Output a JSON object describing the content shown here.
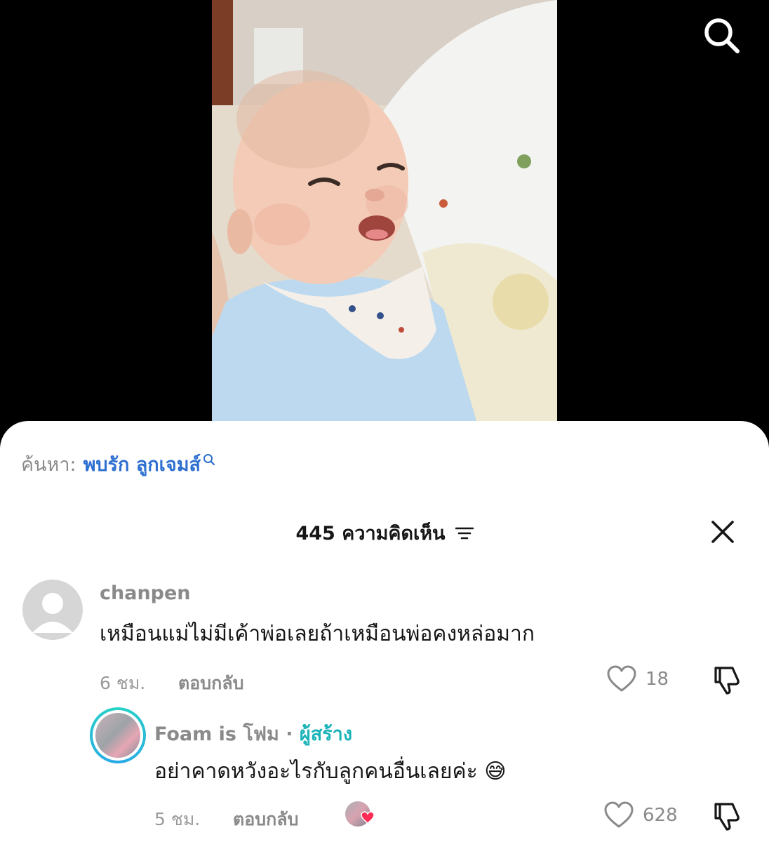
{
  "search_suggestion": {
    "prefix": "ค้นหา:",
    "term": "พบรัก ลูกเจมส์"
  },
  "comments_header": {
    "count": "445",
    "label": "ความคิดเห็น"
  },
  "comments": [
    {
      "username": "chanpen",
      "text": "เหมือนแม่ไม่มีเค้าพ่อเลยถ้าเหมือนพ่อคงหล่อมาก",
      "time": "6 ชม.",
      "reply_label": "ตอบกลับ",
      "likes": "18"
    },
    {
      "username": "Foam is โฟม",
      "separator": "·",
      "badge": "ผู้สร้าง",
      "text": "อย่าคาดหวังอะไรกับลูกคนอื่นเลยค่ะ 😅",
      "time": "5 ชม.",
      "reply_label": "ตอบกลับ",
      "likes": "628"
    }
  ],
  "icons": {
    "search": "search-icon",
    "close": "close-icon",
    "sort": "sort-icon",
    "heart": "heart-icon",
    "dislike": "thumbs-down-icon"
  },
  "colors": {
    "link": "#2d6fd0",
    "creator": "#19b3b8",
    "muted": "#8a8a8a",
    "heart_red": "#fe2c55"
  }
}
